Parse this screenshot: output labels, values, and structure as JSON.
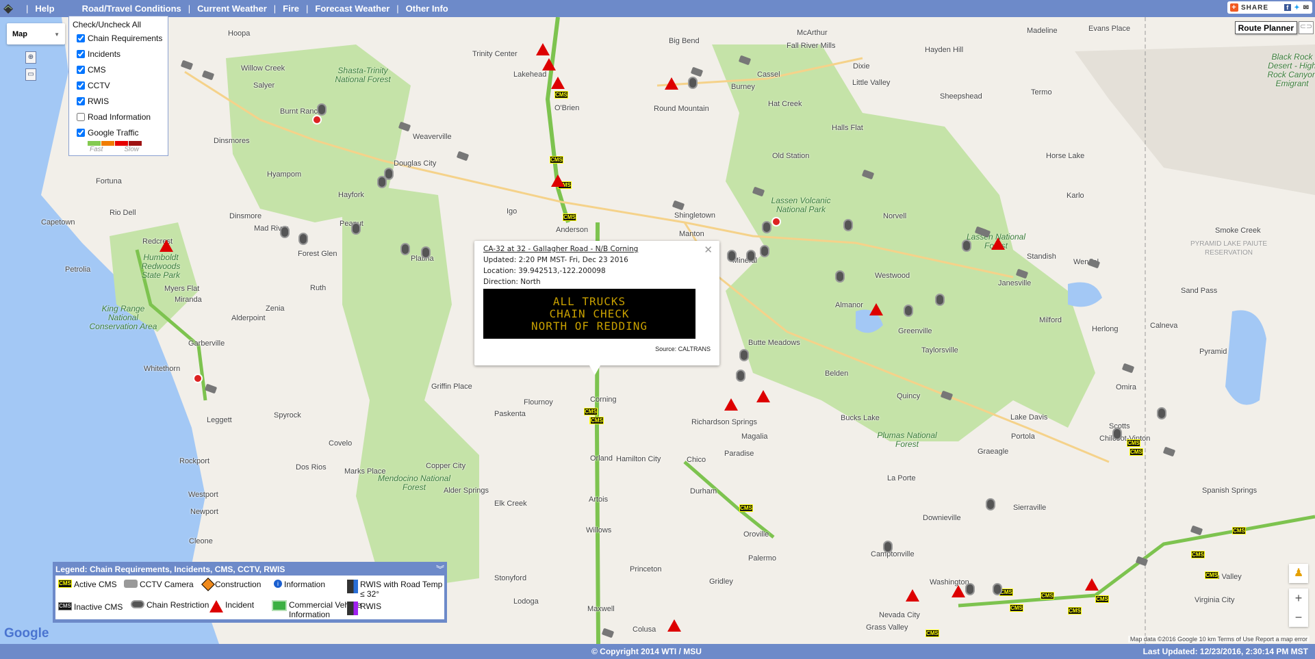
{
  "nav": {
    "items": [
      "Help",
      "Road/Travel Conditions",
      "Current Weather",
      "Fire",
      "Forecast Weather",
      "Other Info"
    ],
    "share_label": "SHARE"
  },
  "layers": {
    "check_all": "Check/Uncheck All",
    "items": [
      {
        "label": "Chain Requirements",
        "checked": true
      },
      {
        "label": "Incidents",
        "checked": true
      },
      {
        "label": "CMS",
        "checked": true
      },
      {
        "label": "CCTV",
        "checked": true
      },
      {
        "label": "RWIS",
        "checked": true
      },
      {
        "label": "Road Information",
        "checked": false
      },
      {
        "label": "Google Traffic",
        "checked": true
      }
    ],
    "traffic_colors": [
      "#84ca50",
      "#f07d02",
      "#e60000",
      "#9e1313"
    ],
    "fast_label": "Fast",
    "slow_label": "Slow"
  },
  "map_type": "Map",
  "route_planner": "Route Planner",
  "popup": {
    "title": "CA-32 at 32 - Gallagher Road - N/B Corning",
    "updated": "Updated: 2:20 PM MST- Fri, Dec 23 2016",
    "location": "Location: 39.942513,-122.200098",
    "direction": "Direction: North",
    "sign_lines": [
      "ALL TRUCKS",
      "CHAIN CHECK",
      "NORTH OF REDDING"
    ],
    "source": "Source: CALTRANS"
  },
  "legend": {
    "title": "Legend: Chain Requirements, Incidents, CMS, CCTV, RWIS",
    "items": [
      "Active CMS",
      "CCTV Camera",
      "Construction",
      "Information",
      "RWIS with Road Temp ≤ 32°",
      "Inactive CMS",
      "Chain Restriction",
      "Incident",
      "Commercial Vehicle Information",
      "RWIS"
    ]
  },
  "map": {
    "places": [
      "Hoopa",
      "Willow Creek",
      "Salyer",
      "Burnt Ranch",
      "Dinsmores",
      "Weaverville",
      "Trinity Center",
      "Big Bend",
      "McArthur",
      "Fall River Mills",
      "Madeline",
      "Evans Place",
      "Hayden Hill",
      "Dixie",
      "Little Valley",
      "Cassel",
      "Burney",
      "Round Mountain",
      "Hat Creek",
      "Sheepshead",
      "Termo",
      "Halls Flat",
      "Old Station",
      "Horse Lake",
      "Karlo",
      "Igo",
      "Shingletown",
      "Manton",
      "Anderson",
      "Hayfork",
      "Hyampom",
      "Douglas City",
      "Fortuna",
      "Rio Dell",
      "Capetown",
      "Dinsmore",
      "Mad River",
      "Forest Glen",
      "Peanut",
      "Platina",
      "Ruth",
      "Petrolia",
      "Myers Flat",
      "Miranda",
      "Zenia",
      "Alderpoint",
      "Garberville",
      "Whitethorn",
      "Leggett",
      "Spyrock",
      "Covelo",
      "Rockport",
      "Dos Rios",
      "Marks Place",
      "Westport",
      "Newport",
      "Cleone",
      "Copper City",
      "Alder Springs",
      "Elk Creek",
      "Stonyford",
      "Lodoga",
      "Griffin Place",
      "Paskenta",
      "Flournoy",
      "Corning",
      "Orland",
      "Hamilton City",
      "Chico",
      "Durham",
      "Paradise",
      "Magalia",
      "Richardson Springs",
      "Artois",
      "Willows",
      "Princeton",
      "Maxwell",
      "Colusa",
      "Gridley",
      "Oroville",
      "Palermo",
      "Butte Meadows",
      "Mineral",
      "Westwood",
      "Almanor",
      "Greenville",
      "Taylorsville",
      "Belden",
      "Quincy",
      "Bucks Lake",
      "Lake Davis",
      "Portola",
      "Graeagle",
      "La Porte",
      "Downieville",
      "Sierraville",
      "Camptonville",
      "Nevada City",
      "Grass Valley",
      "Chilcoot-Vinton",
      "Scotts",
      "Spanish Springs",
      "Sun Valley",
      "Virginia City",
      "Sand Pass",
      "Milford",
      "Herlong",
      "Calneva",
      "Standish",
      "Wendel",
      "Janesville",
      "Smoke Creek",
      "Norvell",
      "Pyramid",
      "Omira",
      "Redcrest",
      "Lakehead",
      "O'Brien",
      "Washington"
    ],
    "areas": [
      "Shasta-Trinity National Forest",
      "Lassen Volcanic National Park",
      "Humboldt Redwoods State Park",
      "King Range National Conservation Area",
      "Mendocino National Forest",
      "Plumas National Forest",
      "Lassen National Forest",
      "PYRAMID LAKE PAIUTE RESERVATION",
      "Black Rock Desert - High Rock Canyon Emigrant"
    ]
  },
  "footer": {
    "copyright": "© Copyright 2014 WTI / MSU",
    "last_updated": "Last Updated: 12/23/2016, 2:30:14 PM MST",
    "attribution": "Map data ©2016 Google   10 km   Terms of Use   Report a map error",
    "google": "Google"
  }
}
